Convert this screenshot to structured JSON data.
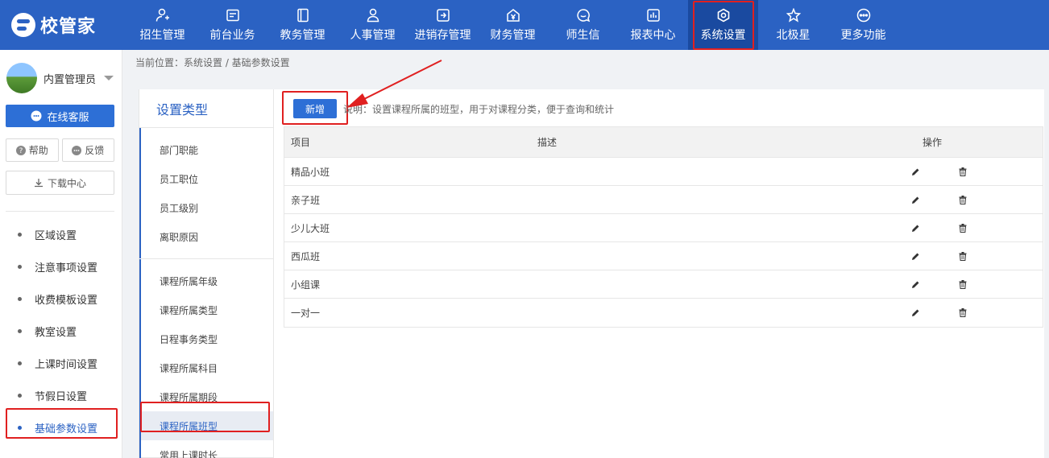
{
  "brand": {
    "name": "校管家"
  },
  "nav": [
    {
      "label": "招生管理",
      "icon": "user-plus-icon"
    },
    {
      "label": "前台业务",
      "icon": "card-icon"
    },
    {
      "label": "教务管理",
      "icon": "book-icon"
    },
    {
      "label": "人事管理",
      "icon": "person-icon"
    },
    {
      "label": "进销存管理",
      "icon": "box-arrow-icon"
    },
    {
      "label": "财务管理",
      "icon": "yuan-house-icon"
    },
    {
      "label": "师生信",
      "icon": "chat-icon"
    },
    {
      "label": "报表中心",
      "icon": "chart-icon"
    },
    {
      "label": "系统设置",
      "icon": "gear-icon",
      "active": true
    },
    {
      "label": "北极星",
      "icon": "star-icon"
    },
    {
      "label": "更多功能",
      "icon": "more-icon"
    }
  ],
  "user": {
    "name": "内置管理员"
  },
  "sidebar": {
    "service_label": "在线客服",
    "help_label": "帮助",
    "feedback_label": "反馈",
    "download_label": "下载中心",
    "menu": [
      {
        "label": "区域设置"
      },
      {
        "label": "注意事项设置"
      },
      {
        "label": "收费模板设置"
      },
      {
        "label": "教室设置"
      },
      {
        "label": "上课时间设置"
      },
      {
        "label": "节假日设置"
      },
      {
        "label": "基础参数设置",
        "active": true
      }
    ]
  },
  "breadcrumb": "当前位置：系统设置 / 基础参数设置",
  "types": {
    "title": "设置类型",
    "group1": [
      {
        "label": "部门职能"
      },
      {
        "label": "员工职位"
      },
      {
        "label": "员工级别"
      },
      {
        "label": "离职原因"
      }
    ],
    "group2": [
      {
        "label": "课程所属年级"
      },
      {
        "label": "课程所属类型"
      },
      {
        "label": "日程事务类型"
      },
      {
        "label": "课程所属科目"
      },
      {
        "label": "课程所属期段"
      },
      {
        "label": "课程所属班型",
        "active": true
      },
      {
        "label": "常用上课时长"
      }
    ]
  },
  "toolbar": {
    "add_label": "新增",
    "note": "说明：设置课程所属的班型，用于对课程分类，便于查询和统计"
  },
  "table": {
    "headers": {
      "item": "项目",
      "desc": "描述",
      "ops": "操作"
    },
    "rows": [
      {
        "item": "精品小班",
        "desc": ""
      },
      {
        "item": "亲子班",
        "desc": ""
      },
      {
        "item": "少儿大班",
        "desc": ""
      },
      {
        "item": "西瓜班",
        "desc": ""
      },
      {
        "item": "小组课",
        "desc": ""
      },
      {
        "item": "一对一",
        "desc": ""
      }
    ]
  },
  "colors": {
    "primary": "#2b62c3",
    "button": "#2d6fd6",
    "highlight": "#e02020"
  }
}
